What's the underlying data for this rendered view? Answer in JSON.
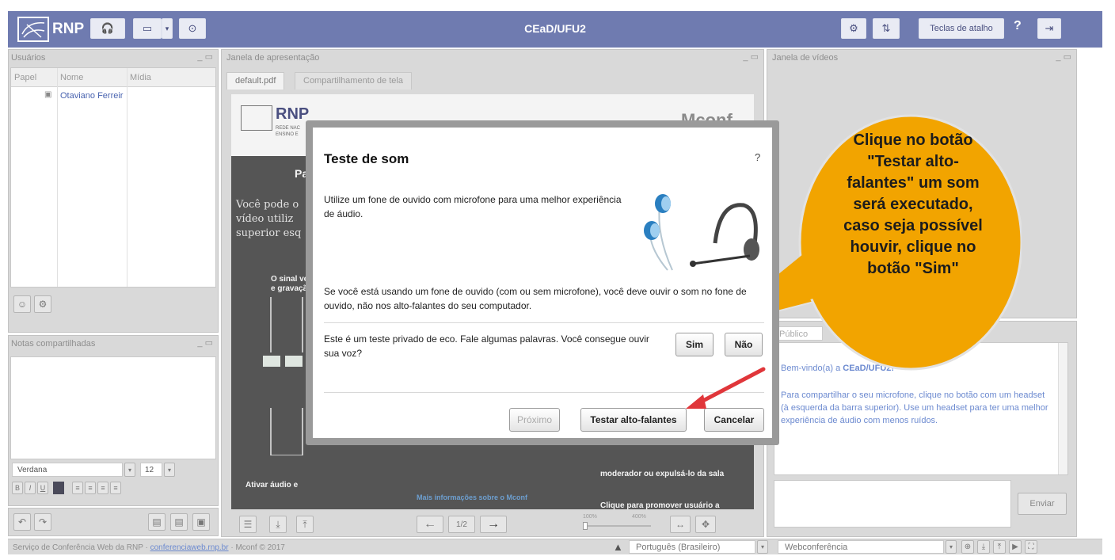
{
  "topbar": {
    "logo": "RNP",
    "title": "CEaD/UFU2",
    "shortcuts_label": "Teclas de atalho",
    "help_label": "?"
  },
  "users_panel": {
    "title": "Usuários",
    "columns": [
      "Papel",
      "Nome",
      "Mídia"
    ],
    "rows": [
      {
        "name": "Otaviano Ferreir"
      }
    ]
  },
  "notes_panel": {
    "title": "Notas compartilhadas",
    "font": "Verdana",
    "font_size": "12",
    "format_buttons": [
      "B",
      "I",
      "U"
    ]
  },
  "presentation_panel": {
    "title": "Janela de apresentação",
    "tabs": [
      "default.pdf",
      "Compartilhamento de tela"
    ],
    "slide": {
      "logo": "RNP",
      "logo_sub1": "REDE NAC",
      "logo_sub2": "ENSINO E",
      "heading_partial": "Part",
      "heading_right": "Mconf",
      "body_lines": [
        "Você pode o",
        "vídeo utiliz",
        "superior esq"
      ],
      "signal_lines": [
        "O sinal ve",
        "e gravaçã"
      ],
      "activate_label": "Ativar áudio e",
      "promote_line1": "Clique para promover usuário a",
      "promote_line2": "moderador ou expulsá-lo da sala",
      "more_info": "Mais informações sobre o Mconf"
    },
    "page": "1/2",
    "zoom_min": "100%",
    "zoom_max": "400%"
  },
  "video_panel": {
    "title": "Janela de vídeos"
  },
  "chat_panel": {
    "tab": "Público",
    "welcome_prefix": "Bem-vindo(a) a ",
    "welcome_room": "CEaD/UFU2!",
    "message": "Para compartilhar o seu microfone, clique no botão com um headset (à esquerda da barra superior). Use um headset para ter uma melhor experiência de áudio com menos ruídos.",
    "send_label": "Enviar"
  },
  "dialog": {
    "title": "Teste de som",
    "help": "?",
    "intro": "Utilize um fone de ouvido com microfone para uma melhor experiência de áudio.",
    "instruction": "Se você está usando um fone de ouvido (com ou sem microfone), você deve ouvir o som no fone de ouvido, não nos alto-falantes do seu computador.",
    "echo_question": "Este é um teste privado de eco. Fale algumas palavras. Você consegue ouvir sua voz?",
    "yes_label": "Sim",
    "no_label": "Não",
    "next_label": "Próximo",
    "test_speakers_label": "Testar alto-falantes",
    "cancel_label": "Cancelar"
  },
  "callout": {
    "lines": [
      "Clique no botão",
      "\"Testar alto-",
      "falantes\" um som",
      "será executado,",
      "caso seja possível",
      "houvir, clique no",
      "botão \"Sim\""
    ]
  },
  "footer": {
    "service_prefix": "Serviço de Conferência Web da RNP · ",
    "service_link": "conferenciaweb.rnp.br",
    "service_suffix": " · Mconf © 2017",
    "language": "Português (Brasileiro)",
    "layout": "Webconferência"
  },
  "colors": {
    "topbar": "#6f7bb0",
    "callout": "#f2a400",
    "arrow": "#e0363a"
  }
}
